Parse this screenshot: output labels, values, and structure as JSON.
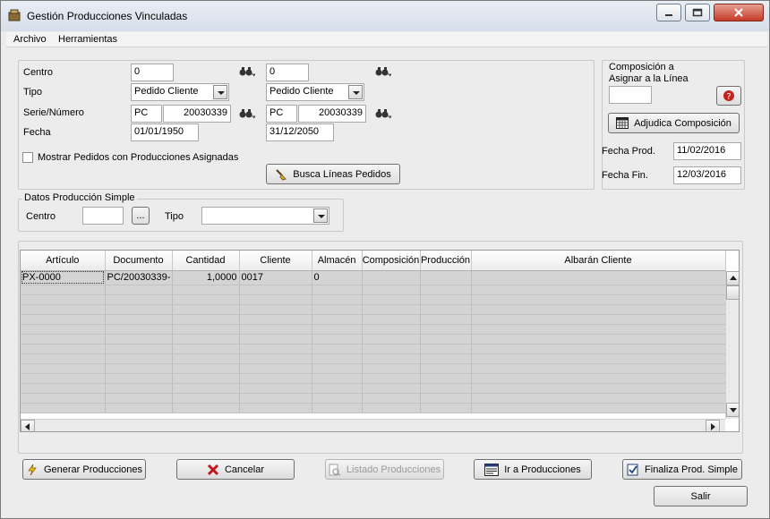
{
  "window": {
    "title": "Gestión Producciones Vinculadas"
  },
  "menu": [
    "Archivo",
    "Herramientas"
  ],
  "filters": {
    "centro_label": "Centro",
    "centro_from": "0",
    "centro_to": "0",
    "tipo_label": "Tipo",
    "tipo_from": "Pedido Cliente",
    "tipo_to": "Pedido Cliente",
    "serie_label": "Serie/Número",
    "serie_from": "PC",
    "numero_from": "20030339",
    "serie_to": "PC",
    "numero_to": "20030339",
    "fecha_label": "Fecha",
    "fecha_from": "01/01/1950",
    "fecha_to": "31/12/2050",
    "mostrar_label": "Mostrar Pedidos con Producciones Asignadas",
    "busca_button": "Busca Líneas Pedidos"
  },
  "composicion": {
    "label": "Composición a Asignar a la Línea",
    "value": "",
    "adjudica_button": "Adjudica Composición",
    "fecha_prod_label": "Fecha Prod.",
    "fecha_prod": "11/02/2016",
    "fecha_fin_label": "Fecha Fin.",
    "fecha_fin": "12/03/2016"
  },
  "simple": {
    "title": "Datos Producción Simple",
    "centro_label": "Centro",
    "centro_value": "",
    "dots_button": "...",
    "tipo_label": "Tipo",
    "tipo_value": ""
  },
  "grid": {
    "columns": [
      "Artículo",
      "Documento",
      "Cantidad",
      "Cliente",
      "Almacén",
      "Composición",
      "Producción",
      "Albarán Cliente"
    ],
    "rows": [
      [
        "PX-0000",
        "PC/20030339-",
        "1,0000",
        "0017",
        "0",
        "",
        "",
        ""
      ]
    ]
  },
  "buttons": {
    "generar": "Generar Producciones",
    "cancelar": "Cancelar",
    "listado": "Listado Producciones",
    "ir": "Ir a Producciones",
    "finaliza": "Finaliza Prod. Simple",
    "salir": "Salir"
  },
  "colors": {
    "grid_row_bg": "#d4d4d4",
    "close_button": "#c53a26"
  }
}
